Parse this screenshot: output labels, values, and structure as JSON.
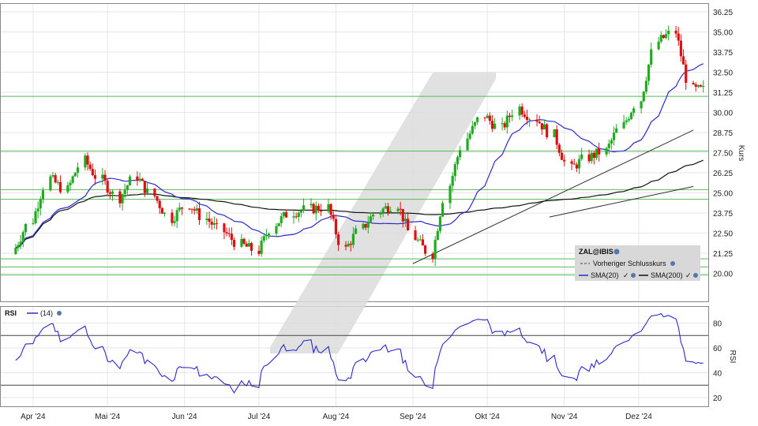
{
  "chart_data": {
    "type": "candlestick",
    "legend": {
      "symbol": "ZAL@IBIS",
      "previous_close_label": "Vorheriger Schlusskurs",
      "sma20_label": "SMA(20)",
      "sma200_label": "SMA(200)"
    },
    "price_panel": {
      "ylabel": "Kurs",
      "ylim": [
        18.75,
        36.25
      ],
      "yticks": [
        "36.25",
        "35.00",
        "33.75",
        "32.50",
        "31.25",
        "30.00",
        "28.75",
        "27.50",
        "26.25",
        "25.00",
        "23.75",
        "22.50",
        "21.25",
        "20.00"
      ],
      "support_resistance_levels": [
        31.0,
        27.6,
        25.2,
        24.6,
        20.9,
        20.4,
        19.9
      ],
      "trendlines": [
        {
          "from": [
            "2024-09-01",
            20.6
          ],
          "to": [
            "2024-12-23",
            28.9
          ]
        },
        {
          "from": [
            "2024-10-26",
            23.5
          ],
          "to": [
            "2024-12-23",
            25.4
          ]
        }
      ],
      "candles_close": [
        {
          "date": "2024-03-25",
          "close": 21.6
        },
        {
          "date": "2024-04-01",
          "close": 23.3
        },
        {
          "date": "2024-04-08",
          "close": 25.9
        },
        {
          "date": "2024-04-15",
          "close": 25.2
        },
        {
          "date": "2024-04-22",
          "close": 27.0
        },
        {
          "date": "2024-04-29",
          "close": 25.8
        },
        {
          "date": "2024-05-06",
          "close": 24.7
        },
        {
          "date": "2024-05-13",
          "close": 26.0
        },
        {
          "date": "2024-05-20",
          "close": 24.8
        },
        {
          "date": "2024-05-27",
          "close": 23.4
        },
        {
          "date": "2024-06-03",
          "close": 24.3
        },
        {
          "date": "2024-06-10",
          "close": 23.4
        },
        {
          "date": "2024-06-17",
          "close": 22.6
        },
        {
          "date": "2024-06-24",
          "close": 21.8
        },
        {
          "date": "2024-07-01",
          "close": 21.4
        },
        {
          "date": "2024-07-08",
          "close": 23.1
        },
        {
          "date": "2024-07-15",
          "close": 23.8
        },
        {
          "date": "2024-07-22",
          "close": 24.0
        },
        {
          "date": "2024-07-29",
          "close": 24.1
        },
        {
          "date": "2024-08-05",
          "close": 21.5
        },
        {
          "date": "2024-08-12",
          "close": 22.8
        },
        {
          "date": "2024-08-19",
          "close": 23.9
        },
        {
          "date": "2024-08-26",
          "close": 24.3
        },
        {
          "date": "2024-09-02",
          "close": 22.2
        },
        {
          "date": "2024-09-09",
          "close": 21.2
        },
        {
          "date": "2024-09-16",
          "close": 25.5
        },
        {
          "date": "2024-09-23",
          "close": 28.4
        },
        {
          "date": "2024-09-30",
          "close": 29.8
        },
        {
          "date": "2024-10-07",
          "close": 29.0
        },
        {
          "date": "2024-10-14",
          "close": 30.3
        },
        {
          "date": "2024-10-21",
          "close": 29.6
        },
        {
          "date": "2024-10-28",
          "close": 28.6
        },
        {
          "date": "2024-11-04",
          "close": 26.5
        },
        {
          "date": "2024-11-11",
          "close": 27.2
        },
        {
          "date": "2024-11-18",
          "close": 27.6
        },
        {
          "date": "2024-11-25",
          "close": 29.2
        },
        {
          "date": "2024-12-02",
          "close": 30.8
        },
        {
          "date": "2024-12-09",
          "close": 34.4
        },
        {
          "date": "2024-12-16",
          "close": 35.0
        },
        {
          "date": "2024-12-23",
          "close": 31.4
        }
      ]
    },
    "rsi_panel": {
      "label": "RSI",
      "period_label": "(14)",
      "ylabel": "RSI",
      "ylim": [
        13,
        93
      ],
      "yticks": [
        "80",
        "60",
        "40",
        "20"
      ],
      "levels": [
        70,
        30
      ]
    },
    "x_axis": {
      "labels": [
        "Apr '24",
        "Mai '24",
        "Jun '24",
        "Jul '24",
        "Aug '24",
        "Sep '24",
        "Okt '24",
        "Nov '24",
        "Dez '24"
      ],
      "label_dates": [
        "2024-04-01",
        "2024-05-01",
        "2024-06-01",
        "2024-07-01",
        "2024-08-01",
        "2024-09-01",
        "2024-10-01",
        "2024-11-01",
        "2024-12-01"
      ],
      "range": [
        "2024-03-19",
        "2024-12-29"
      ]
    },
    "colors": {
      "up": "#22aa22",
      "down": "#dd1111",
      "sma20": "#2a2acc",
      "sma200": "#111111",
      "levels": "#55bb55",
      "rsi": "#2a2acc"
    },
    "grid": true
  }
}
